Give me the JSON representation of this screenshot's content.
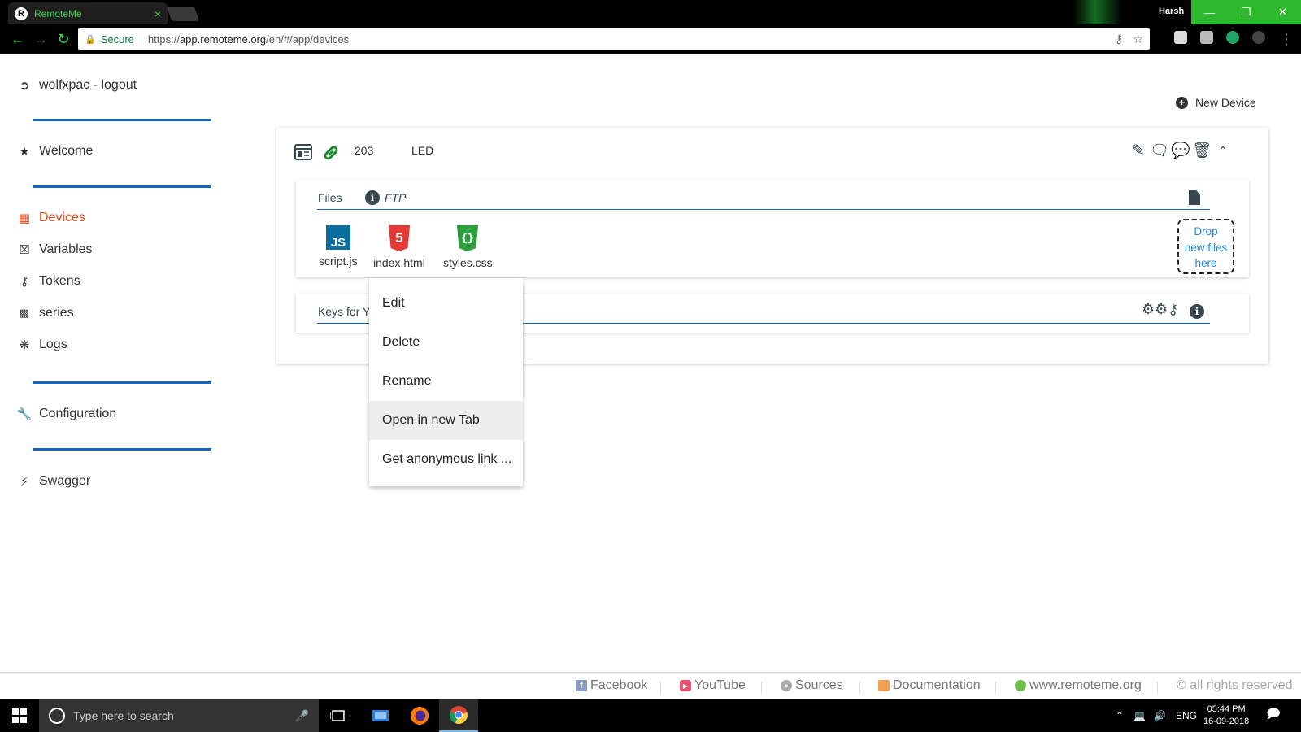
{
  "browser": {
    "tab_title": "RemoteMe",
    "tab_close": "×",
    "user": "Harsh",
    "secure_label": "Secure",
    "url_prefix": "https://",
    "url_host": "app.remoteme.org",
    "url_path": "/en/#/app/devices",
    "win_minimize": "—",
    "win_restore": "❐",
    "win_close": "✕"
  },
  "sidebar": {
    "items": [
      {
        "label": "wolfxpac - logout",
        "icon": "logout-icon"
      },
      {
        "label": "Welcome",
        "icon": "star-icon"
      },
      {
        "label": "Devices",
        "icon": "device-icon",
        "active": true
      },
      {
        "label": "Variables",
        "icon": "variable-icon"
      },
      {
        "label": "Tokens",
        "icon": "key-icon"
      },
      {
        "label": "series",
        "icon": "chart-icon"
      },
      {
        "label": "Logs",
        "icon": "bug-icon"
      },
      {
        "label": "Configuration",
        "icon": "wrench-icon"
      },
      {
        "label": "Swagger",
        "icon": "plug-icon"
      }
    ],
    "active_color": "#e64a19",
    "divider_color": "#1565c0"
  },
  "main": {
    "new_device_label": "New Device",
    "device": {
      "id": "203",
      "name": "LED",
      "files_label": "Files",
      "ftp_label": "FTP",
      "files": [
        {
          "name": "script.js",
          "icon": "js-file-icon",
          "color": "#0a6e9e"
        },
        {
          "name": "index.html",
          "icon": "html5-file-icon",
          "color": "#e53935"
        },
        {
          "name": "styles.css",
          "icon": "css-file-icon",
          "color": "#2e9e3e"
        }
      ],
      "drop_zone": [
        "Drop",
        "new files",
        "here"
      ],
      "keys_label": "Keys for Y"
    }
  },
  "context_menu": {
    "items": [
      "Edit",
      "Delete",
      "Rename",
      "Open in new Tab",
      "Get anonymous link ..."
    ],
    "highlighted": "Open in new Tab"
  },
  "footer": {
    "links": [
      {
        "label": "Facebook",
        "icon": "facebook-icon"
      },
      {
        "label": "YouTube",
        "icon": "youtube-icon"
      },
      {
        "label": "Sources",
        "icon": "github-icon"
      },
      {
        "label": "Documentation",
        "icon": "book-icon"
      },
      {
        "label": "www.remoteme.org",
        "icon": "globe-icon"
      }
    ],
    "rights": "© all rights reserved"
  },
  "taskbar": {
    "search_placeholder": "Type here to search",
    "language": "ENG",
    "time": "05:44 PM",
    "date": "16-09-2018"
  }
}
